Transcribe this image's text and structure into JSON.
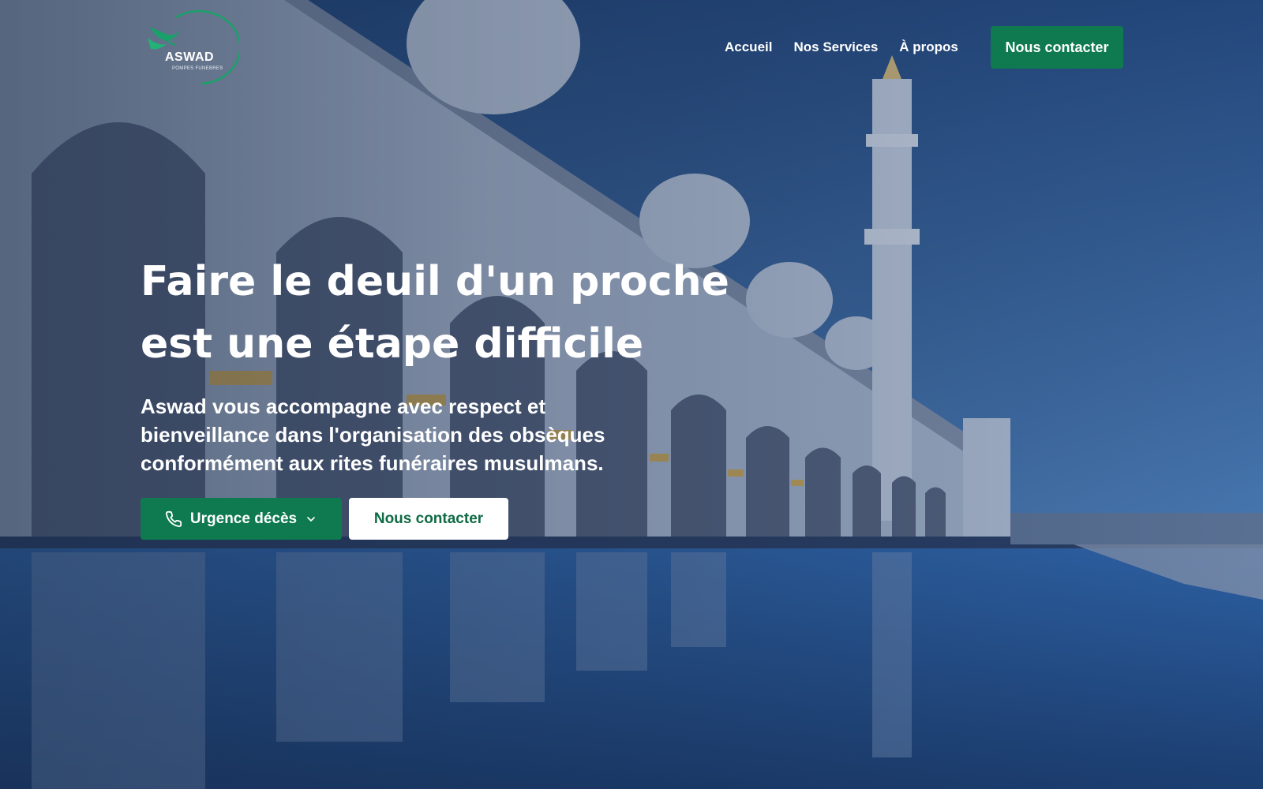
{
  "header": {
    "logo": {
      "name": "ASWAD",
      "tagline": "POMPES FUNEBRES"
    },
    "nav": [
      {
        "label": "Accueil"
      },
      {
        "label": "Nos Services"
      },
      {
        "label": "À propos"
      }
    ],
    "cta_label": "Nous contacter"
  },
  "hero": {
    "headline_line1": "Faire le deuil d'un proche",
    "headline_line2": "est une étape difficile",
    "subtext": "Aswad vous accompagne avec respect et bienveillance dans l'organisation des obsèques conformément aux rites funéraires musulmans.",
    "primary_button": {
      "label": "Urgence décès",
      "icon": "phone-icon",
      "dropdown_icon": "chevron-down-icon"
    },
    "secondary_button": {
      "label": "Nous contacter"
    }
  },
  "colors": {
    "brand_green": "#0f7a4f",
    "sky_blue": "#2a5594",
    "text": "#ffffff"
  }
}
